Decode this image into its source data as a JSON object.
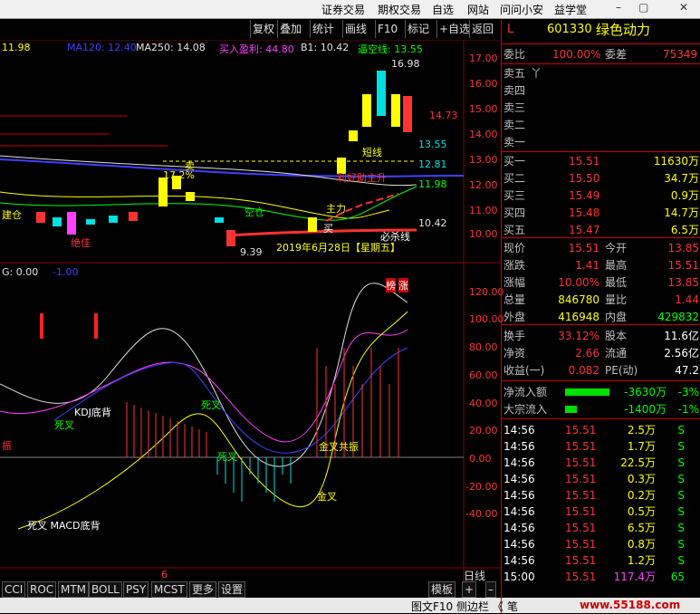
{
  "menu": {
    "items": [
      "证券交易",
      "期权交易",
      "自选",
      "网站",
      "问问小安",
      "益学堂"
    ]
  },
  "window_controls": {
    "minimize": "–",
    "restore": "▢",
    "close": "✕"
  },
  "toolbar": {
    "buttons": [
      "复权",
      "叠加",
      "统计",
      "画线",
      "F10",
      "标记",
      "+自选",
      "返回"
    ]
  },
  "main_chart": {
    "indicators": {
      "ma_first": "11.98",
      "ma120": "MA120: 12.40",
      "ma250": "MA250: 14.08",
      "buy_profit": "买入盈利: 44.80",
      "b1": "B1: 10.42",
      "tongkong": "逼空线: 13.55"
    },
    "price_axis": [
      "17.00",
      "16.00",
      "15.00",
      "14.00",
      "13.00",
      "12.00",
      "11.00",
      "10.00"
    ],
    "price_tags": [
      "14.73",
      "13.55",
      "12.81",
      "11.98",
      "10.42"
    ],
    "high_label": "16.98",
    "low_label": "9.39",
    "annotations": {
      "sell": "卖",
      "jiancang": "建仓",
      "kongcang": "空仓",
      "zhuli": "主力",
      "duanxian": "短线",
      "jueju": "绝佳",
      "bishaxian": "必杀线",
      "lihaozhusheng": "利好助主升",
      "buy_label": "买",
      "zhang": "涨",
      "ju": "榜",
      "percent": "17.2%",
      "date_tag": "2019年6月28日【星期五】"
    }
  },
  "sub_chart": {
    "header": {
      "a": "G: 0.00",
      "b": "-1.00"
    },
    "axis": [
      "120.00",
      "100.00",
      "80.00",
      "60.00",
      "40.00",
      "20.00",
      "0.00",
      "-20.00",
      "-40.00"
    ],
    "labels": {
      "kdj_bottom": "KDJ底背",
      "dead_cross1": "死叉",
      "dead_cross2": "死叉",
      "dead_cross3": "死叉",
      "golden_resonance": "金叉共振",
      "golden_cross": "金叉",
      "macd_bottom": "死叉 MACD底背",
      "zhen": "振",
      "axis_tab": "6"
    }
  },
  "bottom_tabs": [
    "CCI",
    "ROC",
    "MTM",
    "BOLL",
    "PSY",
    "MCST",
    "更多",
    "设置"
  ],
  "bottom_right": {
    "template": "模板",
    "plus": "+",
    "minus": "–",
    "left": "◀",
    "right": "▶",
    "period": "日线"
  },
  "footer": {
    "left": "图文F10",
    "sidebar": "侧边栏 《",
    "pen": "笔",
    "watermark": "www.55188.com"
  },
  "quote": {
    "market": "L",
    "code": "601330",
    "name": "绿色动力",
    "weibi_label": "委比",
    "weibi_val": "100.00%",
    "weicha_label": "委差",
    "weicha_val": "75349",
    "sell_levels": [
      "卖五",
      "卖四",
      "卖三",
      "卖二",
      "卖一"
    ],
    "sell_mark": "丫",
    "buy_levels": [
      {
        "label": "买一",
        "price": "15.51",
        "vol": "11630万"
      },
      {
        "label": "买二",
        "price": "15.50",
        "vol": "34.7万"
      },
      {
        "label": "买三",
        "price": "15.49",
        "vol": "0.9万"
      },
      {
        "label": "买四",
        "price": "15.48",
        "vol": "14.7万"
      },
      {
        "label": "买五",
        "price": "15.47",
        "vol": "6.5万"
      }
    ],
    "stats": [
      {
        "l1": "现价",
        "v1": "15.51",
        "l2": "今开",
        "v2": "13.85"
      },
      {
        "l1": "涨跌",
        "v1": "1.41",
        "l2": "最高",
        "v2": "15.51"
      },
      {
        "l1": "涨幅",
        "v1": "10.00%",
        "l2": "最低",
        "v2": "13.85"
      },
      {
        "l1": "总量",
        "v1": "846780",
        "l2": "量比",
        "v2": "1.44"
      },
      {
        "l1": "外盘",
        "v1": "416948",
        "l2": "内盘",
        "v2": "429832"
      }
    ],
    "stats2": [
      {
        "l1": "换手",
        "v1": "33.12%",
        "l2": "股本",
        "v2": "11.6亿"
      },
      {
        "l1": "净资",
        "v1": "2.66",
        "l2": "流通",
        "v2": "2.56亿"
      },
      {
        "l1": "收益(一)",
        "v1": "0.082",
        "l2": "PE(动)",
        "v2": "47.2"
      }
    ],
    "flow": [
      {
        "label": "净流入额",
        "bar": 0.7,
        "val": "-3630万",
        "pct": "-3%"
      },
      {
        "label": "大宗流入",
        "bar": 0.18,
        "val": "-1400万",
        "pct": "-1%"
      }
    ],
    "ticks": [
      {
        "t": "14:56",
        "p": "15.51",
        "v": "2.5万",
        "s": "S"
      },
      {
        "t": "14:56",
        "p": "15.51",
        "v": "1.7万",
        "s": "S"
      },
      {
        "t": "14:56",
        "p": "15.51",
        "v": "22.5万",
        "s": "S"
      },
      {
        "t": "14:56",
        "p": "15.51",
        "v": "0.3万",
        "s": "S"
      },
      {
        "t": "14:56",
        "p": "15.51",
        "v": "0.2万",
        "s": "S"
      },
      {
        "t": "14:56",
        "p": "15.51",
        "v": "0.5万",
        "s": "S"
      },
      {
        "t": "14:56",
        "p": "15.51",
        "v": "6.5万",
        "s": "S"
      },
      {
        "t": "14:56",
        "p": "15.51",
        "v": "0.8万",
        "s": "S"
      },
      {
        "t": "14:56",
        "p": "15.51",
        "v": "1.2万",
        "s": "S"
      },
      {
        "t": "15:00",
        "p": "15.51",
        "v": "117.4万",
        "s": "65"
      }
    ]
  },
  "colors": {
    "up": "#ff3232",
    "down": "#00e0e0",
    "yellow": "#ffff00",
    "label": "#c0c0c0",
    "grid": "#8b0000"
  }
}
